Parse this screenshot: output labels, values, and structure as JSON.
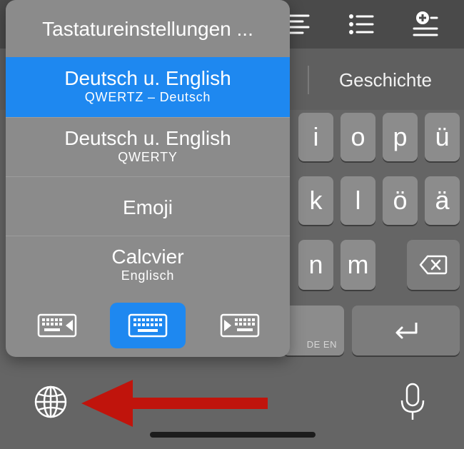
{
  "popup": {
    "title": "Tastatureinstellungen ...",
    "items": [
      {
        "title": "Deutsch u. English",
        "subtitle": "QWERTZ – Deutsch",
        "selected": true
      },
      {
        "title": "Deutsch u. English",
        "subtitle": "QWERTY",
        "selected": false
      },
      {
        "title": "Emoji",
        "subtitle": "",
        "selected": false
      },
      {
        "title": "Calcvier",
        "subtitle": "Englisch",
        "selected": false
      }
    ],
    "layout_buttons": [
      "keyboard-left-icon",
      "keyboard-icon",
      "keyboard-right-icon"
    ]
  },
  "suggestion": {
    "word": "Geschichte"
  },
  "keys": {
    "row1": [
      "i",
      "o",
      "p",
      "ü"
    ],
    "row2": [
      "k",
      "l",
      "ö",
      "ä"
    ],
    "row3": [
      "n",
      "m"
    ],
    "space_label": "DE EN"
  },
  "colors": {
    "accent": "#1e88f0",
    "arrow": "#c0140c"
  }
}
